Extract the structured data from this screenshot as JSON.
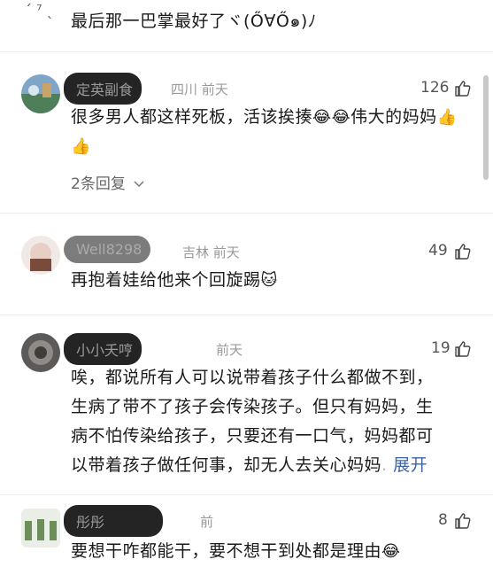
{
  "top_comment": {
    "text": "最后那一巴掌最好了ヾ(Ő∀Ő๑)ﾉ",
    "fragment": "ˊ ⁷ ˎ"
  },
  "comments": [
    {
      "username": "定英副食",
      "location": "四川",
      "time": "前天",
      "likes": "126",
      "text": "很多男人都这样死板，活该挨揍",
      "text_tail": "伟大的妈妈",
      "emoji_crying": "😂",
      "emoji_thumb": "👍",
      "replies_label": "2条回复"
    },
    {
      "username": "Well8298",
      "location": "吉林",
      "time": "前天",
      "likes": "49",
      "text": "再抱着娃给他来个回旋踢",
      "emoji_cat": "🐱"
    },
    {
      "username": "小小夭哼",
      "time": "前天",
      "likes": "19",
      "text_lines": [
        "唉，都说所有人可以说带着孩子什么都做不到，",
        "生病了带不了孩子会传染孩子。但只有妈妈，生",
        "病不怕传染给孩子，只要还有一口气，妈妈都可",
        "以带着孩子做任何事，却无人去关心妈妈"
      ],
      "expand_label": "展开"
    },
    {
      "username": "彤彤",
      "time": "前",
      "likes": "8",
      "text": "要想干咋都能干，要不想干到处都是理由",
      "emoji_crying": "😂"
    }
  ],
  "colors": {
    "accent_link": "#3b64a8",
    "meta_gray": "#9a9a9a"
  },
  "icons": {
    "like": "thumbs-up-outline-icon",
    "expand": "chevron-down-icon"
  }
}
